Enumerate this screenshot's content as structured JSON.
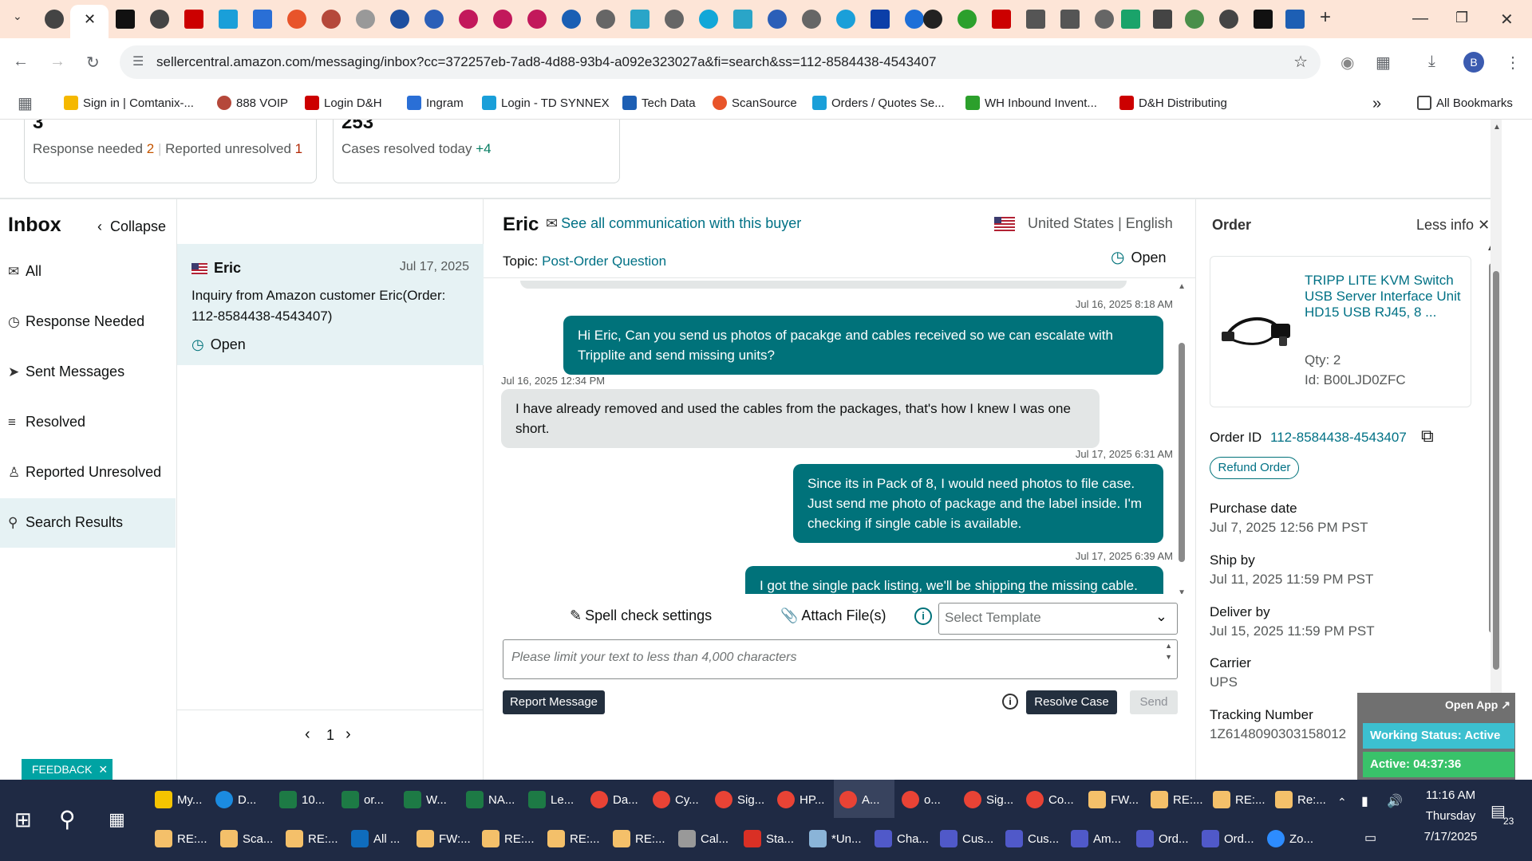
{
  "browser": {
    "url": "sellercentral.amazon.com/messaging/inbox?cc=372257eb-7ad8-4d88-93b4-a092e323027a&fi=search&ss=112-8584438-4543407",
    "bookmarks": [
      "Sign in | Comtanix-...",
      "888 VOIP",
      "Login D&H",
      "Ingram",
      "Login - TD SYNNEX",
      "Tech Data",
      "ScanSource",
      "Orders / Quotes Se...",
      "WH Inbound Invent...",
      "D&H Distributing"
    ],
    "all_bookmarks": "All Bookmarks",
    "profile_initial": "B"
  },
  "stats": {
    "card1": {
      "value": "3",
      "response_label": "Response needed",
      "response_count": "2",
      "divider": "|",
      "unresolved_label": "Reported unresolved",
      "unresolved_count": "1"
    },
    "card2": {
      "value": "253",
      "resolved_label": "Cases resolved today",
      "resolved_delta": "+4"
    }
  },
  "inbox": {
    "title": "Inbox",
    "collapse": "Collapse",
    "items": [
      {
        "label": "All",
        "icon": "mail-icon"
      },
      {
        "label": "Response Needed",
        "icon": "clock-icon"
      },
      {
        "label": "Sent Messages",
        "icon": "send-icon"
      },
      {
        "label": "Resolved",
        "icon": "resolved-icon"
      },
      {
        "label": "Reported Unresolved",
        "icon": "person-icon"
      },
      {
        "label": "Search Results",
        "icon": "search-icon"
      }
    ]
  },
  "conversation_list": {
    "name": "Eric",
    "date": "Jul 17, 2025",
    "subject": "Inquiry from Amazon customer Eric(Order: 112-8584438-4543407)",
    "status": "Open",
    "page": "1"
  },
  "chat": {
    "buyer_name": "Eric",
    "see_all": "See all communication with this buyer",
    "country": "United States",
    "separator": "|",
    "language": "English",
    "topic_label": "Topic:",
    "topic_value": "Post-Order Question",
    "status": "Open",
    "messages": [
      {
        "ts": "Jul 16, 2025 8:18 AM",
        "text": "Hi Eric, Can you send us photos of pacakge and cables received so we can escalate with Tripplite and send missing units?"
      },
      {
        "ts": "Jul 16, 2025 12:34 PM",
        "text": "I have already removed and used the cables from the packages, that's how I knew I was one short."
      },
      {
        "ts": "Jul 17, 2025 6:31 AM",
        "text": "Since its in Pack of 8, I would need photos to file case. Just send me photo of package and the label inside. I'm checking if single cable is available."
      },
      {
        "ts": "Jul 17, 2025 6:39 AM",
        "text": "I got the single pack listing, we'll be shipping the missing cable."
      }
    ],
    "spell_check": "Spell check settings",
    "attach": "Attach File(s)",
    "template_placeholder": "Select Template",
    "textarea_placeholder": "Please limit your text to less than 4,000 characters",
    "report": "Report Message",
    "resolve": "Resolve Case",
    "send": "Send"
  },
  "order": {
    "title": "Order",
    "less_info": "Less info",
    "product_title": "TRIPP LITE KVM Switch USB Server Interface Unit HD15 USB RJ45, 8 ...",
    "qty": "Qty: 2",
    "asin": "Id: B00LJD0ZFC",
    "order_id_label": "Order ID",
    "order_id": "112-8584438-4543407",
    "refund": "Refund Order",
    "purchase_label": "Purchase date",
    "purchase_value": "Jul 7, 2025 12:56 PM PST",
    "ship_label": "Ship by",
    "ship_value": "Jul 11, 2025 11:59 PM PST",
    "deliver_label": "Deliver by",
    "deliver_value": "Jul 15, 2025 11:59 PM PST",
    "carrier_label": "Carrier",
    "carrier_value": "UPS",
    "tracking_label": "Tracking Number",
    "tracking_value": "1Z6148090303158012"
  },
  "widgets": {
    "feedback": "FEEDBACK",
    "open_app": "Open App",
    "working_status": "Working Status: Active",
    "active_timer": "Active: 04:37:36"
  },
  "taskbar": {
    "row1": [
      "My...",
      "D...",
      "10...",
      "or...",
      "W...",
      "NA...",
      "Le...",
      "Da...",
      "Cy...",
      "Sig...",
      "HP...",
      "A...",
      "o...",
      "Sig...",
      "Co...",
      "FW...",
      "RE:...",
      "RE:...",
      "Re:..."
    ],
    "row2": [
      "RE:...",
      "Sca...",
      "RE:...",
      "All ...",
      "FW:...",
      "RE:...",
      "RE:...",
      "RE:...",
      "Cal...",
      "Sta...",
      "*Un...",
      "Cha...",
      "Cus...",
      "Cus...",
      "Am...",
      "Ord...",
      "Ord...",
      "Zo..."
    ],
    "time": "11:16 AM",
    "day": "Thursday",
    "date": "7/17/2025",
    "notifications": "23"
  }
}
